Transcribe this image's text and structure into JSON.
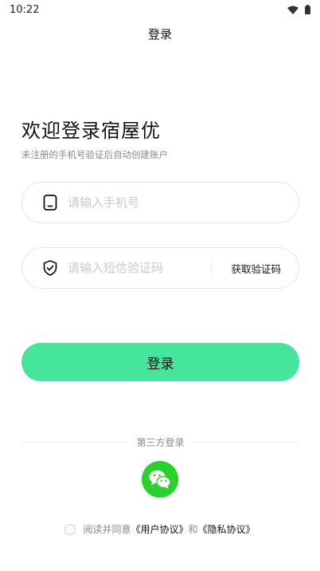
{
  "status_bar": {
    "time": "10:22"
  },
  "nav": {
    "title": "登录"
  },
  "welcome": {
    "title": "欢迎登录宿屋优",
    "subtitle": "未注册的手机号验证后自动创建账户"
  },
  "phone_field": {
    "placeholder": "请输入手机号",
    "value": ""
  },
  "code_field": {
    "placeholder": "请输入短信验证码",
    "value": "",
    "get_code_label": "获取验证码"
  },
  "login_button": {
    "label": "登录"
  },
  "third_party": {
    "label": "第三方登录",
    "wechat_icon": "wechat-icon"
  },
  "agreement": {
    "prefix": "阅读并同意",
    "user_agreement": "《用户协议》",
    "conjunction": "和",
    "privacy_agreement": "《隐私协议》"
  },
  "colors": {
    "accent": "#46e59c",
    "wechat": "#28d12c",
    "placeholder": "#c9c9c9"
  }
}
